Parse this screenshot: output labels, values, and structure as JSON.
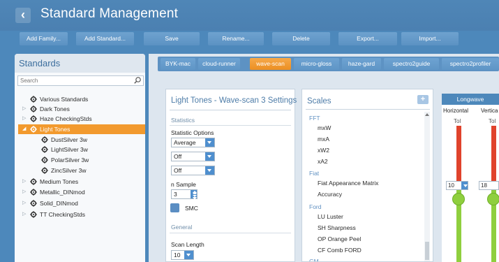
{
  "app": {
    "title": "Standard Management"
  },
  "toolbar": {
    "add_family": "Add Family...",
    "add_standard": "Add Standard...",
    "save": "Save",
    "rename": "Rename...",
    "delete": "Delete",
    "export": "Export...",
    "import": "Import..."
  },
  "standards": {
    "title": "Standards",
    "search_placeholder": "Search",
    "tree": [
      {
        "label": "Various Standards",
        "expandable": false
      },
      {
        "label": "Dark Tones",
        "expandable": true
      },
      {
        "label": "Haze CheckingStds",
        "expandable": true
      },
      {
        "label": "Light Tones",
        "expandable": true,
        "expanded": true,
        "selected": true
      },
      {
        "label": "DustSilver 3w",
        "child": true
      },
      {
        "label": "LightSilver 3w",
        "child": true
      },
      {
        "label": "PolarSilver 3w",
        "child": true
      },
      {
        "label": "ZincSilver 3w",
        "child": true
      },
      {
        "label": "Medium Tones",
        "expandable": true
      },
      {
        "label": "Metallic_DINmod",
        "expandable": true
      },
      {
        "label": "Solid_DINmod",
        "expandable": true
      },
      {
        "label": "TT CheckingStds",
        "expandable": true
      }
    ]
  },
  "tabs": [
    "BYK-mac",
    "cloud-runner",
    "wave-scan",
    "micro-gloss",
    "haze-gard",
    "spectro2guide",
    "spectro2profiler"
  ],
  "active_tab": "wave-scan",
  "settings": {
    "title": "Light Tones - Wave-scan 3 Settings",
    "statistics_header": "Statistics",
    "statistic_options_label": "Statistic Options",
    "dropdown1": "Average",
    "dropdown2": "Off",
    "dropdown3": "Off",
    "n_sample_label": "n Sample",
    "n_sample_value": "3",
    "smc_label": "SMC",
    "general_header": "General",
    "scan_length_label": "Scan Length",
    "scan_length_value": "10"
  },
  "scales": {
    "title": "Scales",
    "add_label": "+",
    "groups": [
      {
        "name": "FFT",
        "items": [
          "mxW",
          "mxA",
          "xW2",
          "xA2"
        ]
      },
      {
        "name": "Fiat",
        "items": [
          "Fiat Appearance Matrix",
          "Accuracy"
        ]
      },
      {
        "name": "Ford",
        "items": [
          "LU Luster",
          "SH Sharpness",
          "OP Orange Peel",
          "CF Comb FORD"
        ]
      },
      {
        "name": "GM",
        "items": []
      }
    ]
  },
  "longwave": {
    "header": "Longwave",
    "horizontal_label": "Horizontal",
    "vertical_label": "Vertica",
    "tol_label": "Tol",
    "horizontal_value": "10",
    "vertical_value": "18"
  },
  "colors": {
    "accent": "#4d88bb",
    "selection": "#f29a2e",
    "tolerance_red": "#e0432c",
    "tolerance_green": "#8fcf3e"
  }
}
